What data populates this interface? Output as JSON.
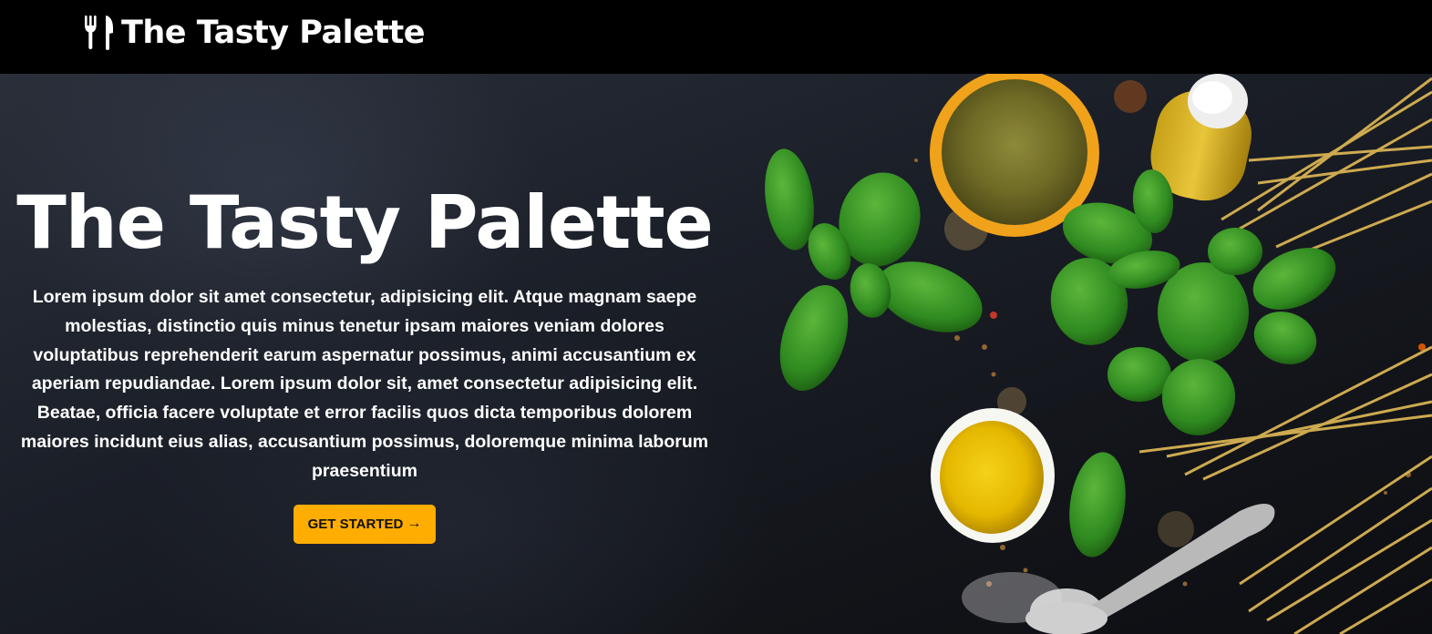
{
  "brand": {
    "name": "The Tasty Palette",
    "icon": "utensils-icon"
  },
  "hero": {
    "title": "The Tasty Palette",
    "text": "Lorem ipsum dolor sit amet consectetur, adipisicing elit. Atque magnam saepe molestias, distinctio quis minus tenetur ipsam maiores veniam dolores voluptatibus reprehenderit earum aspernatur possimus, animi accusantium ex aperiam repudiandae. Lorem ipsum dolor sit, amet consectetur adipisicing elit. Beatae, officia facere voluptate et error facilis quos dicta temporibus dolorem maiores incidunt eius alias, accusantium possimus, doloremque minima laborum praesentium",
    "cta_label": "GET STARTED",
    "cta_icon": "arrow-right-icon",
    "background": "food-ingredients-photo"
  },
  "colors": {
    "navbar": "#000000",
    "accent": "#ffad00",
    "text": "#ffffff"
  }
}
